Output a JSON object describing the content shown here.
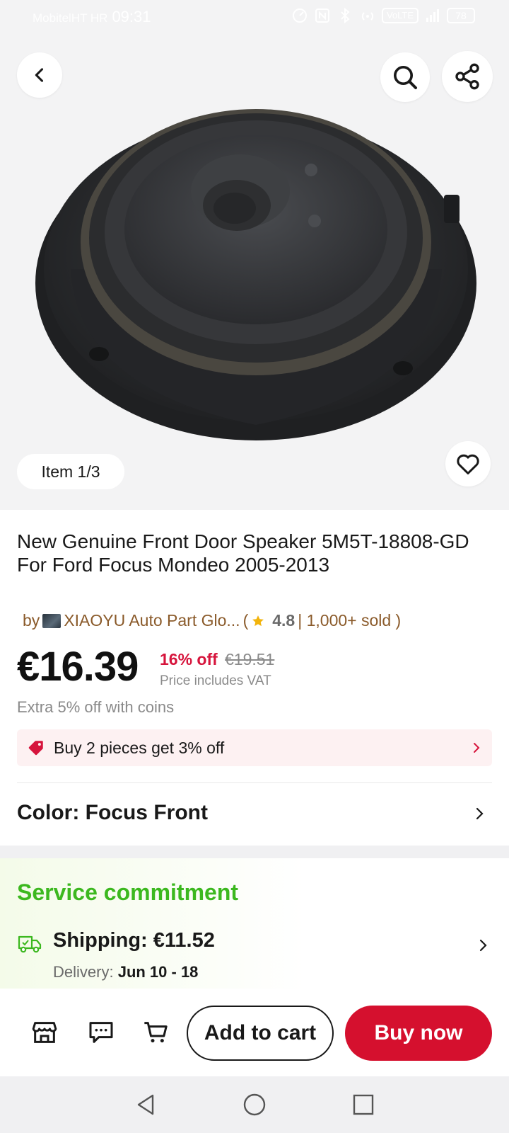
{
  "status_bar": {
    "carrier": "MobitelHT HR",
    "time": "09:31",
    "network_label": "VoLTE",
    "battery": "78"
  },
  "gallery": {
    "item_counter": "Item 1/3"
  },
  "product": {
    "title": "New Genuine Front Door Speaker 5M5T-18808-GD For Ford Focus Mondeo 2005-2013",
    "store_prefix": "by",
    "store_name": "XIAOYU Auto Part Glo...",
    "store_open": "(",
    "rating": "4.8",
    "sold": "| 1,000+ sold )",
    "price": "€16.39",
    "discount": "16% off",
    "original_price": "€19.51",
    "vat_note": "Price includes VAT",
    "coins_note": "Extra 5% off with coins",
    "promo": "Buy 2 pieces get 3% off",
    "color_label": "Color: Focus Front"
  },
  "service": {
    "title": "Service commitment",
    "shipping": "Shipping: €11.52",
    "delivery_prefix": "Delivery:",
    "delivery_dates": "Jun 10 - 18"
  },
  "actions": {
    "add_to_cart": "Add to cart",
    "buy_now": "Buy now"
  },
  "colors": {
    "accent_red": "#d5102e",
    "discount_red": "#d6143c",
    "service_green": "#3cb81f",
    "store_brown": "#8a5a2a",
    "star_yellow": "#f2b40c"
  },
  "icons": {
    "back": "chevron-left-icon",
    "search": "search-icon",
    "share": "share-icon",
    "favorite": "heart-icon",
    "promo": "price-tag-icon",
    "shipping": "truck-icon",
    "store": "store-icon",
    "message": "message-icon",
    "cart": "cart-icon"
  }
}
